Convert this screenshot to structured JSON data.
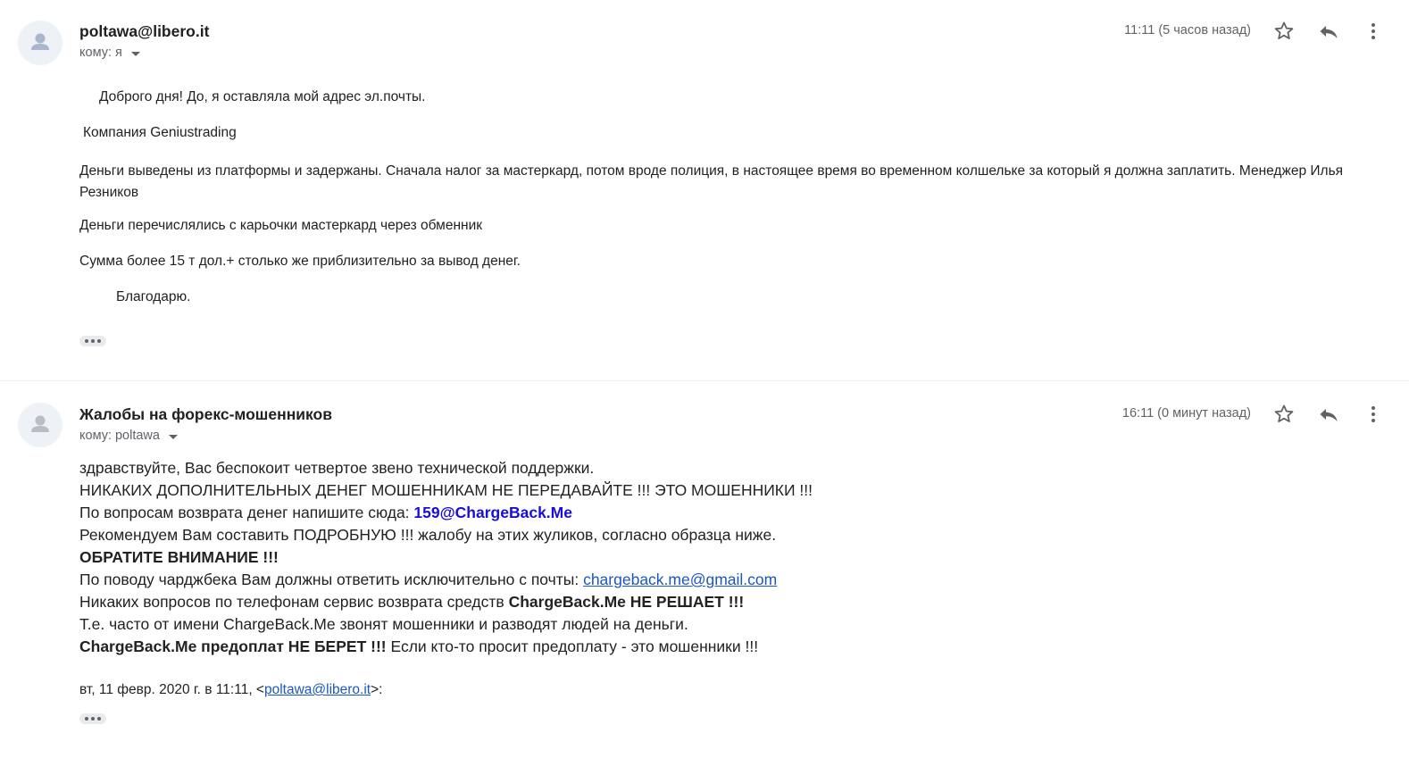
{
  "messages": [
    {
      "sender": "poltawa@libero.it",
      "recipient_prefix": "кому:",
      "recipient": "я",
      "time": "11:11 (5 часов назад)",
      "body": {
        "greeting": "Доброго дня! До, я оставляла мой адрес эл.почты.",
        "company": "Компания Geniustrading",
        "paragraph": "Деньги выведены из платформы и задержаны. Сначала налог за мастеркард, потом вроде полиция, в настоящее время во временном колшельке за который я должна заплатить. Менеджер Илья Резников",
        "transfer": "Деньги перечислялись с карьочки мастеркард через обменник",
        "amount": "Сумма более 15 т дол.+ столько же приблизительно за вывод денег.",
        "thanks": "Благодарю."
      }
    },
    {
      "sender": "Жалобы на форекс-мошенников",
      "recipient_prefix": "кому:",
      "recipient": "poltawa",
      "time": "16:11 (0 минут назад)",
      "body": {
        "line1": "здравствуйте, Вас беспокоит четвертое звено технической поддержки.",
        "line2": "НИКАКИХ ДОПОЛНИТЕЛЬНЫХ ДЕНЕГ МОШЕННИКАМ НЕ ПЕРЕДАВАЙТЕ !!! ЭТО МОШЕННИКИ !!!",
        "line3_text": "По вопросам возврата денег напишите сюда: ",
        "line3_email": "159@ChargeBack.Me",
        "line4": "Рекомендуем Вам составить ПОДРОБНУЮ !!! жалобу на этих жуликов, согласно образца ниже.",
        "line5": "ОБРАТИТЕ ВНИМАНИЕ !!!",
        "line6_text": "По поводу чарджбека Вам должны ответить исключительно с почты: ",
        "line6_email": "chargeback.me@gmail.com",
        "line7_text": "Никаких вопросов по телефонам сервис возврата средств ",
        "line7_bold": "ChargeBack.Me НЕ РЕШАЕТ !!!",
        "line8": "Т.е. часто от имени ChargeBack.Me звонят мошенники и разводят людей на деньги.",
        "line9_bold": "ChargeBack.Me предоплат НЕ БЕРЕТ !!!",
        "line9_text": " Если кто-то просит предоплату - это мошенники !!!"
      },
      "quote": {
        "prefix": "вт, 11 февр. 2020 г. в 11:11, <",
        "email": "poltawa@libero.it",
        "suffix": ">:"
      }
    }
  ],
  "icons": {
    "avatar": "avatar-icon",
    "star": "star-icon",
    "reply": "reply-icon",
    "more": "more-vert-icon",
    "expand": "ellipsis-icon"
  },
  "colors": {
    "link": "#1a56c4",
    "highlight_email": "#1a0dda",
    "muted": "#5f6368"
  }
}
